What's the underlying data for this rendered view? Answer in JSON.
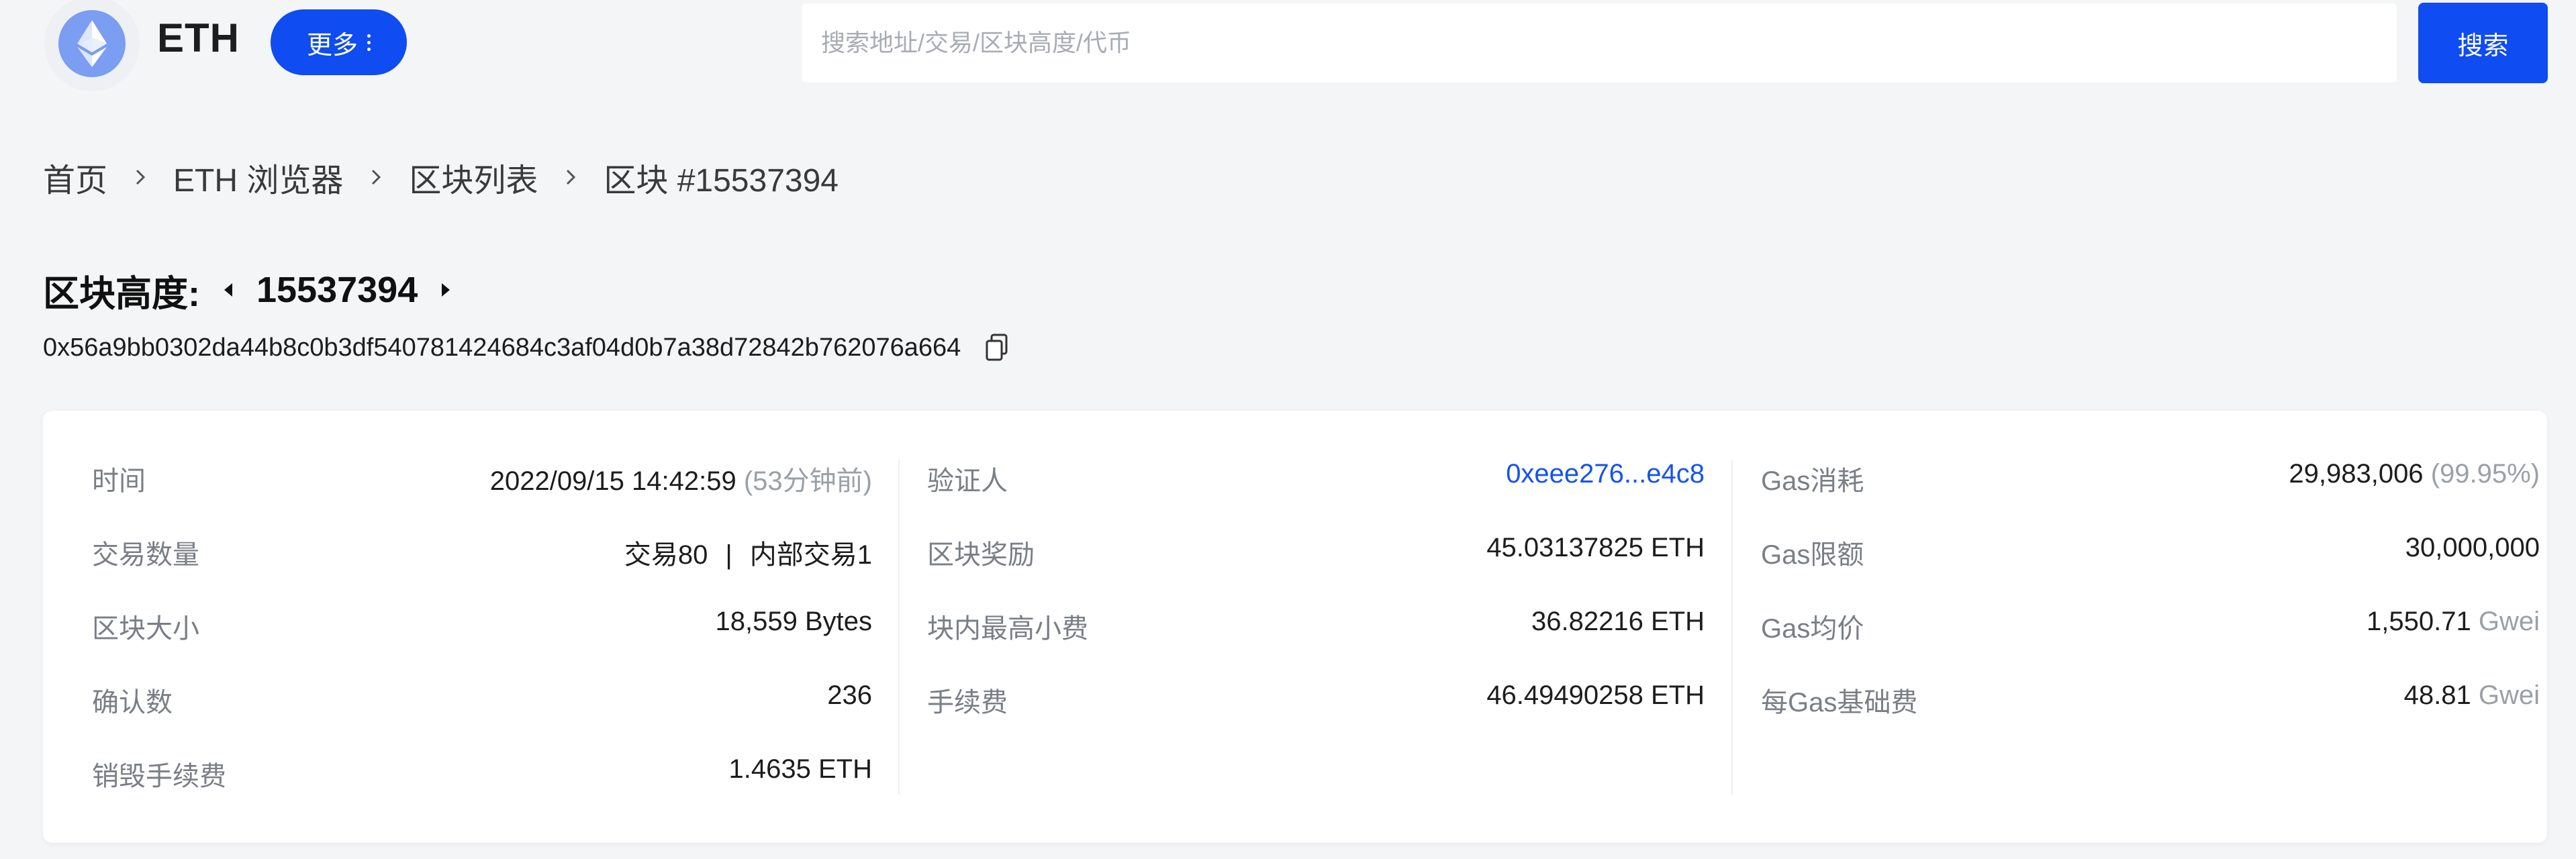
{
  "header": {
    "app_name": "ETH",
    "more_label": "更多",
    "search_placeholder": "搜索地址/交易/区块高度/代币",
    "search_button": "搜索"
  },
  "breadcrumb": [
    "首页",
    "ETH 浏览器",
    "区块列表",
    "区块 #15537394"
  ],
  "block": {
    "height_label": "区块高度:",
    "height": "15537394",
    "hash": "0x56a9bb0302da44b8c0b3df540781424684c3af04d0b7a38d72842b762076a664"
  },
  "details": {
    "col1": [
      {
        "label": "时间",
        "value": "2022/09/15 14:42:59",
        "extra": "(53分钟前)"
      },
      {
        "label": "交易数量",
        "value": "交易80",
        "value2": "内部交易1"
      },
      {
        "label": "区块大小",
        "value": "18,559 Bytes"
      },
      {
        "label": "确认数",
        "value": "236"
      },
      {
        "label": "销毁手续费",
        "value": "1.4635 ETH"
      }
    ],
    "col2": [
      {
        "label": "验证人",
        "value": "0xeee276...e4c8"
      },
      {
        "label": "区块奖励",
        "value": "45.03137825 ETH"
      },
      {
        "label": "块内最高小费",
        "value": "36.82216 ETH"
      },
      {
        "label": "手续费",
        "value": "46.49490258 ETH"
      }
    ],
    "col3": [
      {
        "label": "Gas消耗",
        "value": "29,983,006",
        "extra": "(99.95%)"
      },
      {
        "label": "Gas限额",
        "value": "30,000,000"
      },
      {
        "label": "Gas均价",
        "value": "1,550.71",
        "unit": "Gwei"
      },
      {
        "label": "每Gas基础费",
        "value": "48.81",
        "unit": "Gwei"
      }
    ]
  },
  "colors": {
    "accent": "#0f4cf2",
    "link": "#1453f0",
    "background": "#f4f5f7"
  }
}
